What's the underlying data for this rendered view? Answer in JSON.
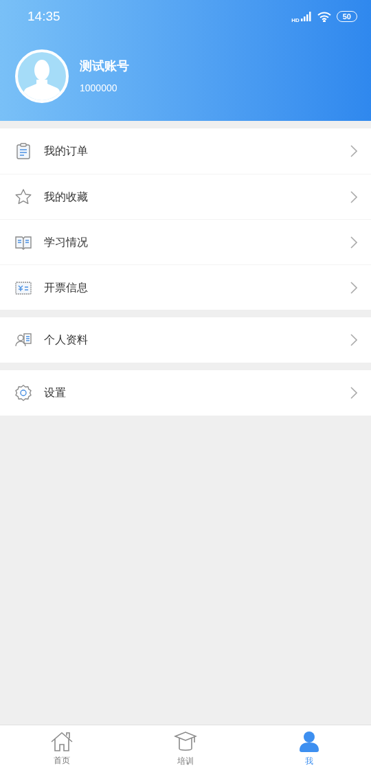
{
  "status_bar": {
    "time": "14:35",
    "network": "HD",
    "battery": "50"
  },
  "profile": {
    "name": "测试账号",
    "account": "1000000"
  },
  "menu_groups": [
    {
      "items": [
        {
          "label": "我的订单",
          "kind": "orders"
        },
        {
          "label": "我的收藏",
          "kind": "favorites"
        },
        {
          "label": "学习情况",
          "kind": "study"
        },
        {
          "label": "开票信息",
          "kind": "invoice"
        }
      ]
    },
    {
      "items": [
        {
          "label": "个人资料",
          "kind": "profile"
        }
      ]
    },
    {
      "items": [
        {
          "label": "设置",
          "kind": "settings"
        }
      ]
    }
  ],
  "tabs": [
    {
      "label": "首页",
      "kind": "home",
      "selected": false
    },
    {
      "label": "培训",
      "kind": "training",
      "selected": false
    },
    {
      "label": "我",
      "kind": "me",
      "selected": true
    }
  ]
}
